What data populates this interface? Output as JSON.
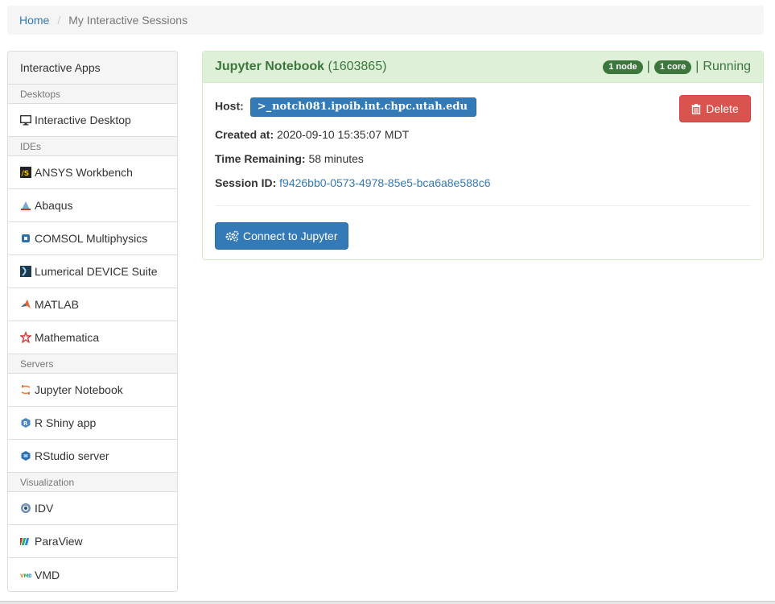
{
  "breadcrumb": {
    "home": "Home",
    "separator": "/",
    "current": "My Interactive Sessions"
  },
  "sidebar": {
    "header": "Interactive Apps",
    "categories": {
      "desktops": "Desktops",
      "ides": "IDEs",
      "servers": "Servers",
      "visualization": "Visualization"
    },
    "items": [
      {
        "label": "Interactive Desktop",
        "icon": "monitor-icon"
      },
      {
        "label": "ANSYS Workbench",
        "icon": "ansys-icon"
      },
      {
        "label": "Abaqus",
        "icon": "abaqus-icon"
      },
      {
        "label": "COMSOL Multiphysics",
        "icon": "comsol-icon"
      },
      {
        "label": "Lumerical DEVICE Suite",
        "icon": "lumerical-icon"
      },
      {
        "label": "MATLAB",
        "icon": "matlab-icon"
      },
      {
        "label": "Mathematica",
        "icon": "mathematica-icon"
      },
      {
        "label": "Jupyter Notebook",
        "icon": "jupyter-icon"
      },
      {
        "label": "R Shiny app",
        "icon": "rshiny-icon"
      },
      {
        "label": "RStudio server",
        "icon": "rstudio-icon"
      },
      {
        "label": "IDV",
        "icon": "idv-icon"
      },
      {
        "label": "ParaView",
        "icon": "paraview-icon"
      },
      {
        "label": "VMD",
        "icon": "vmd-icon"
      }
    ]
  },
  "session": {
    "title": "Jupyter Notebook",
    "id_suffix": "(1603865)",
    "nodes_badge": "1 node",
    "cores_badge": "1 core",
    "status_sep": "|",
    "status": "Running",
    "host_label": "Host:",
    "host_value": "notch081.ipoib.int.chpc.utah.edu",
    "host_prefix": ">_",
    "created_label": "Created at:",
    "created_value": "2020-09-10 15:35:07 MDT",
    "time_label": "Time Remaining:",
    "time_value": "58 minutes",
    "session_id_label": "Session ID:",
    "session_id_value": "f9426bb0-0573-4978-85e5-bca6a8e588c6",
    "delete_label": "Delete",
    "connect_label": "Connect to Jupyter"
  },
  "colors": {
    "primary": "#337ab7",
    "danger": "#d9534f",
    "success_bg": "#dff0d8",
    "success_text": "#3c763d"
  }
}
